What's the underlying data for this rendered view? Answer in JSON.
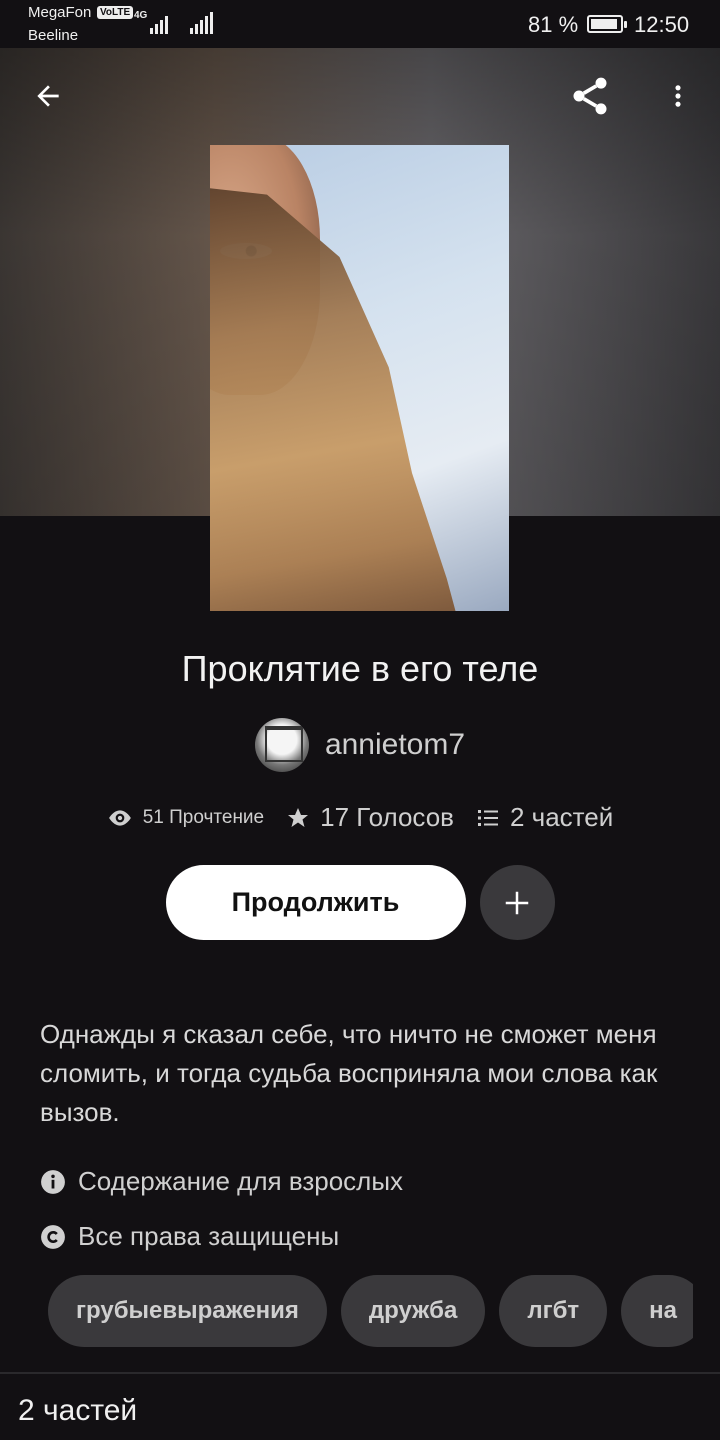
{
  "status_bar": {
    "carrier1": "MegaFon",
    "volte": "VoLTE",
    "network": "4G",
    "carrier2": "Beeline",
    "battery_pct": "81 %",
    "battery_level": 0.81,
    "time": "12:50"
  },
  "toolbar": {
    "back_icon": "arrow-left-icon",
    "share_icon": "share-icon",
    "more_icon": "more-vertical-icon"
  },
  "story": {
    "title": "Проклятие в его теле",
    "author": "annietom7",
    "reads": "51 Прочтение",
    "votes": "17 Голосов",
    "parts": "2 частей",
    "continue_label": "Продолжить",
    "add_icon": "plus-icon",
    "description": "Однажды я сказал себе, что ничто не сможет меня сломить, и тогда судьба восприняла мои слова как вызов.",
    "mature": "Содержание для взрослых",
    "copyright": "Все права защищены"
  },
  "tags": [
    "грубыевыражения",
    "дружба",
    "лгбт",
    "на"
  ],
  "parts_section": {
    "heading": "2 частей"
  },
  "colors": {
    "background": "#121013",
    "button_primary": "#ffffff",
    "chip": "#3a393c"
  }
}
